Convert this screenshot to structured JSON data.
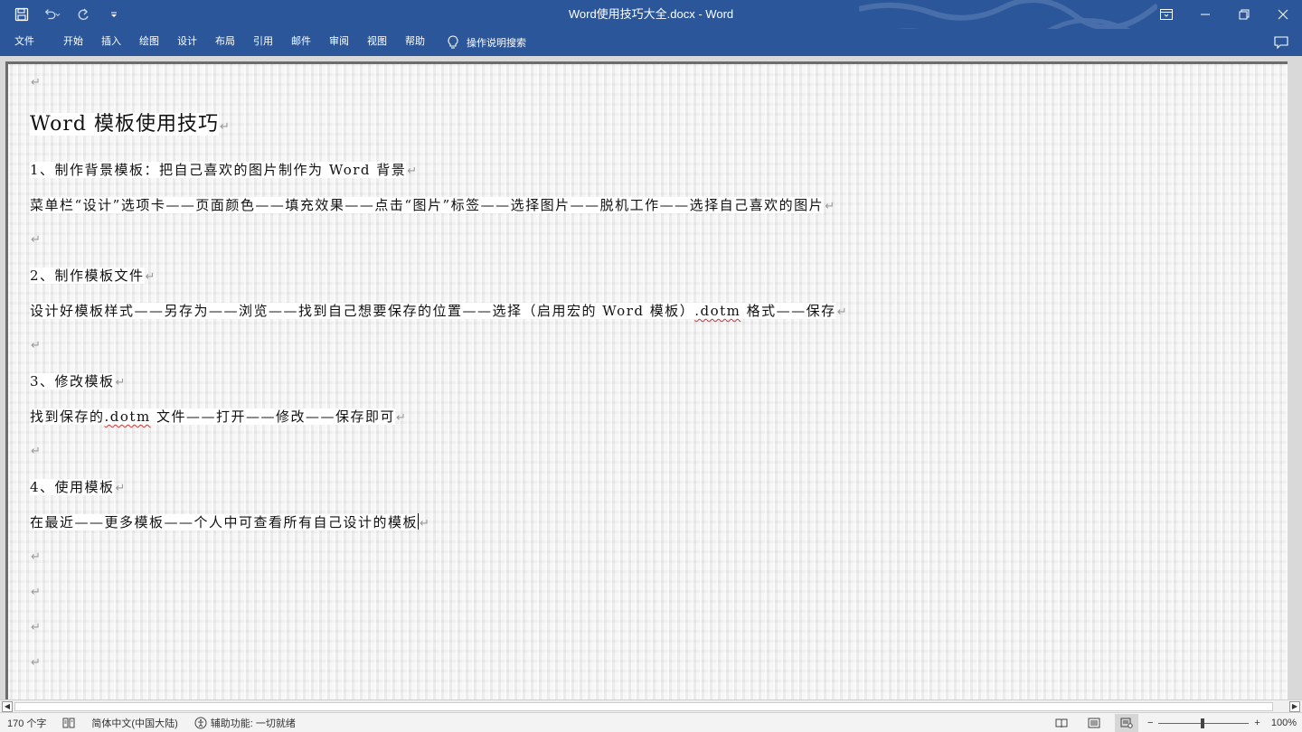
{
  "titlebar": {
    "title": "Word使用技巧大全.docx  -  Word"
  },
  "ribbon": {
    "tabs": [
      "文件",
      "开始",
      "插入",
      "绘图",
      "设计",
      "布局",
      "引用",
      "邮件",
      "审阅",
      "视图",
      "帮助"
    ],
    "tell_me": "操作说明搜索"
  },
  "document": {
    "paragraphs": [
      {
        "text": "",
        "style": "body"
      },
      {
        "text": "Word 模板使用技巧",
        "style": "h1"
      },
      {
        "text": "1、制作背景模板：把自己喜欢的图片制作为 Word 背景",
        "style": "body"
      },
      {
        "text": "菜单栏“设计”选项卡——页面颜色——填充效果——点击“图片”标签——选择图片——脱机工作——选择自己喜欢的图片",
        "style": "body"
      },
      {
        "text": "",
        "style": "body"
      },
      {
        "text": "2、制作模板文件",
        "style": "body"
      },
      {
        "text_before": "设计好模板样式——另存为——浏览——找到自己想要保存的位置——选择（启用宏的 Word 模板）",
        "misspelled": ".dotm",
        "text_after": " 格式——保存",
        "style": "body"
      },
      {
        "text": "",
        "style": "body"
      },
      {
        "text": "3、修改模板",
        "style": "body"
      },
      {
        "text_before": "找到保存的",
        "misspelled": ".dotm",
        "text_after": " 文件——打开——修改——保存即可",
        "style": "body"
      },
      {
        "text": "",
        "style": "body"
      },
      {
        "text": "4、使用模板",
        "style": "body"
      },
      {
        "text": "在最近——更多模板——个人中可查看所有自己设计的模板",
        "style": "body",
        "cursor": true
      },
      {
        "text": "",
        "style": "body"
      },
      {
        "text": "",
        "style": "body"
      },
      {
        "text": "",
        "style": "body"
      },
      {
        "text": "",
        "style": "body"
      }
    ],
    "paragraph_mark": "↵"
  },
  "statusbar": {
    "word_count": "170 个字",
    "language": "简体中文(中国大陆)",
    "accessibility": "辅助功能: 一切就绪",
    "zoom_minus": "−",
    "zoom_plus": "+",
    "zoom_level": "100%",
    "zoom_percent": 100
  },
  "colors": {
    "accent": "#2b579a",
    "misspelling": "#d13438"
  },
  "icons": [
    "save-icon",
    "undo-icon",
    "redo-icon",
    "customize-qat-icon",
    "ribbon-display-options-icon",
    "minimize-icon",
    "restore-icon",
    "close-icon",
    "lightbulb-icon",
    "comments-icon",
    "proofing-icon",
    "accessibility-icon",
    "read-mode-icon",
    "print-layout-icon",
    "web-layout-icon"
  ]
}
